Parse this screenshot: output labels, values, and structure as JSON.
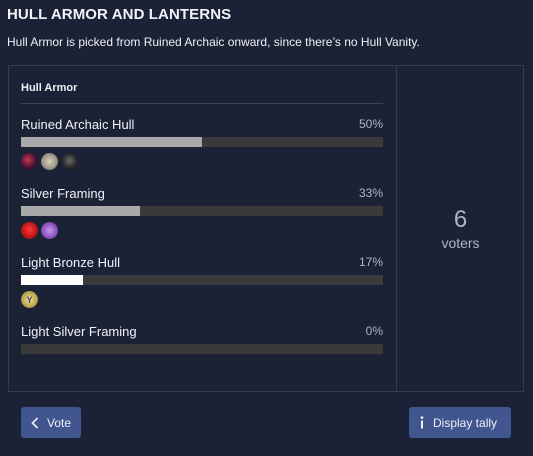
{
  "header": {
    "title": "HULL ARMOR AND LANTERNS",
    "subtitle": "Hull Armor is picked from Ruined Archaic onward, since there’s no Hull Vanity."
  },
  "poll": {
    "section_label": "Hull Armor",
    "options": [
      {
        "label": "Ruined Archaic Hull",
        "percent": "50%",
        "fraction": 0.5,
        "voters": [
          "voter-avatar-1",
          "voter-avatar-2",
          "voter-avatar-3"
        ]
      },
      {
        "label": "Silver Framing",
        "percent": "33%",
        "fraction": 0.33,
        "voters": [
          "voter-avatar-4",
          "voter-avatar-5"
        ]
      },
      {
        "label": "Light Bronze Hull",
        "percent": "17%",
        "fraction": 0.17,
        "voters": [
          "voter-avatar-6"
        ]
      },
      {
        "label": "Light Silver Framing",
        "percent": "0%",
        "fraction": 0.0,
        "voters": []
      }
    ],
    "highlighted_option_index": 2
  },
  "tally": {
    "count": "6",
    "label": "voters"
  },
  "buttons": {
    "vote_label": "Vote",
    "vote_icon": "chevron-left-icon",
    "display_tally_label": "Display tally",
    "display_tally_icon": "info-icon"
  },
  "colors": {
    "background": "#1b2235",
    "button": "#41558f",
    "bar_fill": "#a9a9a9",
    "bar_fill_highlight": "#ffffff",
    "bar_track": "#3a3a3a"
  }
}
